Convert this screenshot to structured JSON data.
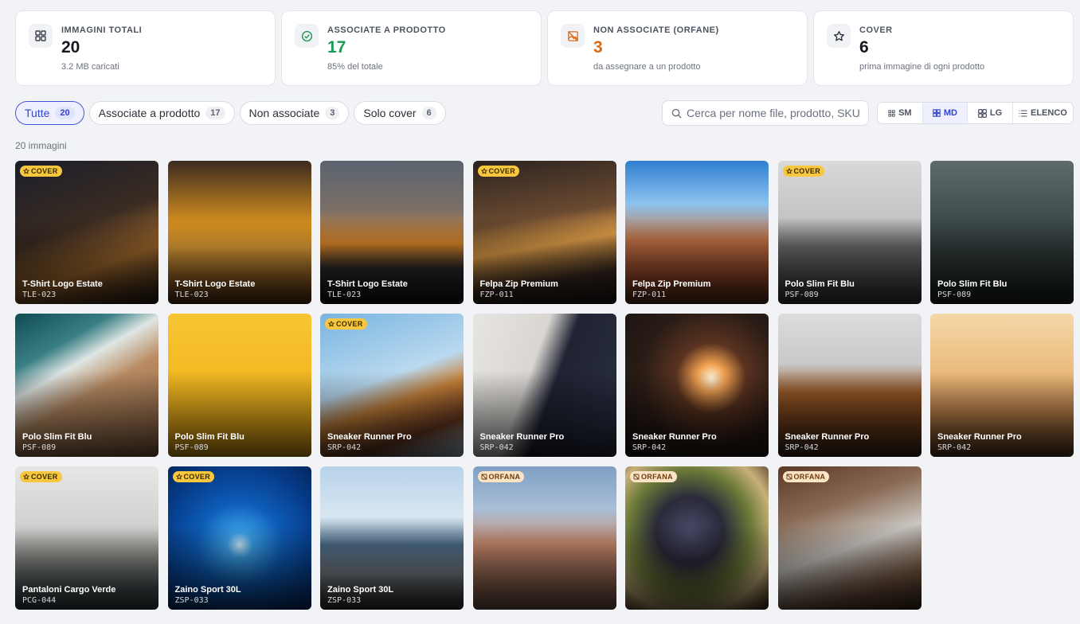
{
  "stats": [
    {
      "label": "IMMAGINI TOTALI",
      "value": "20",
      "sub": "3.2 MB caricati",
      "icon": "grid-icon",
      "tone": "default"
    },
    {
      "label": "ASSOCIATE A PRODOTTO",
      "value": "17",
      "sub": "85% del totale",
      "icon": "check-circle-icon",
      "tone": "green"
    },
    {
      "label": "NON ASSOCIATE (ORFANE)",
      "value": "3",
      "sub": "da assegnare a un prodotto",
      "icon": "image-off-icon",
      "tone": "orange"
    },
    {
      "label": "COVER",
      "value": "6",
      "sub": "prima immagine di ogni prodotto",
      "icon": "star-icon",
      "tone": "default"
    }
  ],
  "filters": [
    {
      "label": "Tutte",
      "count": "20",
      "active": true
    },
    {
      "label": "Associate a prodotto",
      "count": "17",
      "active": false
    },
    {
      "label": "Non associate",
      "count": "3",
      "active": false
    },
    {
      "label": "Solo cover",
      "count": "6",
      "active": false
    }
  ],
  "search": {
    "placeholder": "Cerca per nome file, prodotto, SKU"
  },
  "sizes": [
    {
      "label": "SM",
      "active": false
    },
    {
      "label": "MD",
      "active": true
    },
    {
      "label": "LG",
      "active": false
    },
    {
      "label": "ELENCO",
      "active": false
    }
  ],
  "badges": {
    "cover": "COVER",
    "orphan": "ORFANA"
  },
  "results_count": "20 immagini",
  "images": [
    {
      "name": "T-Shirt Logo Estate",
      "sku": "TLE-023",
      "cover": true,
      "orphan": false,
      "bg": "linear-gradient(160deg,#1b1d2a 0%,#3a2c22 45%,#a36a2c 70%,#221a16 100%)"
    },
    {
      "name": "T-Shirt Logo Estate",
      "sku": "TLE-023",
      "cover": false,
      "orphan": false,
      "bg": "linear-gradient(180deg,#3b2a1f 0%,#d9921f 45%,#e8a43a 60%,#5a3312 100%)"
    },
    {
      "name": "T-Shirt Logo Estate",
      "sku": "TLE-023",
      "cover": false,
      "orphan": false,
      "bg": "linear-gradient(180deg,#5b6470 0%,#7c6f66 35%,#e08a2a 58%,#2e2a2a 75%,#151515 100%)"
    },
    {
      "name": "Felpa Zip Premium",
      "sku": "FZP-011",
      "cover": true,
      "orphan": false,
      "bg": "linear-gradient(170deg,#2b2320 0%,#6a4a30 40%,#e6a24a 58%,#3a2a22 80%,#1c1715 100%)"
    },
    {
      "name": "Felpa Zip Premium",
      "sku": "FZP-011",
      "cover": false,
      "orphan": false,
      "bg": "linear-gradient(180deg,#2f7fd0 0%,#8cc3ee 30%,#c9784a 55%,#9a4a2a 80%,#5e2e1a 100%)"
    },
    {
      "name": "Polo Slim Fit Blu",
      "sku": "PSF-089",
      "cover": true,
      "orphan": false,
      "bg": "linear-gradient(180deg,#d9d9d9 0%,#c4c4c4 40%,#6f6f6f 60%,#3a3a3a 100%)"
    },
    {
      "name": "Polo Slim Fit Blu",
      "sku": "PSF-089",
      "cover": false,
      "orphan": false,
      "bg": "linear-gradient(180deg,#5d6b6a 0%,#3f4d4c 40%,#2a3333 75%,#1f2626 100%)"
    },
    {
      "name": "Polo Slim Fit Blu",
      "sku": "PSF-089",
      "cover": false,
      "orphan": false,
      "bg": "linear-gradient(150deg,#0f4d52 0%,#3a7f85 25%,#dfe6e3 38%,#b98b62 55%,#8c6445 100%)"
    },
    {
      "name": "Polo Slim Fit Blu",
      "sku": "PSF-089",
      "cover": false,
      "orphan": false,
      "bg": "linear-gradient(180deg,#f7c531 0%,#f2b51e 60%,#e6a513 100%)"
    },
    {
      "name": "Sneaker Runner Pro",
      "sku": "SRP-042",
      "cover": true,
      "orphan": false,
      "bg": "linear-gradient(160deg,#79b4e0 0%,#b9d9ef 45%,#c8823a 60%,#6a3a22 80%,#a8cfe8 100%)"
    },
    {
      "name": "Sneaker Runner Pro",
      "sku": "SRP-042",
      "cover": false,
      "orphan": false,
      "bg": "linear-gradient(110deg,#e7e5e2 0%,#d9d6d2 40%,#1f2332 55%,#2a2f45 100%)"
    },
    {
      "name": "Sneaker Runner Pro",
      "sku": "SRP-042",
      "cover": false,
      "orphan": false,
      "bg": "radial-gradient(circle at 60% 45%,#fff7e0 0%,#f0a050 12%,#5a3320 30%,#2a1c16 60%,#1a1310 100%)"
    },
    {
      "name": "Sneaker Runner Pro",
      "sku": "SRP-042",
      "cover": false,
      "orphan": false,
      "bg": "linear-gradient(180deg,#dcdcdc 0%,#c9c9c9 35%,#9a5a28 55%,#6a3a18 80%,#3a2a1e 100%)"
    },
    {
      "name": "Sneaker Runner Pro",
      "sku": "SRP-042",
      "cover": false,
      "orphan": false,
      "bg": "linear-gradient(180deg,#f4d8a8 0%,#eab878 45%,#c4874c 70%,#5a3a22 100%)"
    },
    {
      "name": "Pantaloni Cargo Verde",
      "sku": "PCG-044",
      "cover": true,
      "orphan": false,
      "bg": "linear-gradient(180deg,#e6e6e4 0%,#cfd0cd 45%,#8e8f8a 65%,#4b5b5c 85%,#3a4546 100%)"
    },
    {
      "name": "Zaino Sport 30L",
      "sku": "ZSP-033",
      "cover": true,
      "orphan": false,
      "bg": "radial-gradient(circle at 50% 55%,#cfeefe 0%,#3aa0e8 12%,#0d5cb8 40%,#063a86 75%,#04275e 100%)"
    },
    {
      "name": "Zaino Sport 30L",
      "sku": "ZSP-033",
      "cover": false,
      "orphan": false,
      "bg": "linear-gradient(180deg,#b8d3ea 0%,#d8e6f1 35%,#4c6d8a 55%,#7a8085 75%,#2f3335 100%)"
    },
    {
      "name": "",
      "sku": "",
      "cover": false,
      "orphan": true,
      "bg": "linear-gradient(180deg,#7f9fc4 0%,#a9bfd7 30%,#c98a6c 55%,#9a6a54 80%,#7a5a4c 100%)"
    },
    {
      "name": "",
      "sku": "",
      "cover": false,
      "orphan": true,
      "bg": "radial-gradient(circle at 45% 45%,#4a4a6a 0%,#2a2a3a 30%,#6c7a38 55%,#c9b07a 75%,#3a2a1a 100%)"
    },
    {
      "name": "",
      "sku": "",
      "cover": false,
      "orphan": true,
      "bg": "linear-gradient(160deg,#5a3a24 0%,#8a6a54 30%,#c9c7c2 55%,#7a5a44 80%,#3a2a1e 100%)"
    }
  ]
}
